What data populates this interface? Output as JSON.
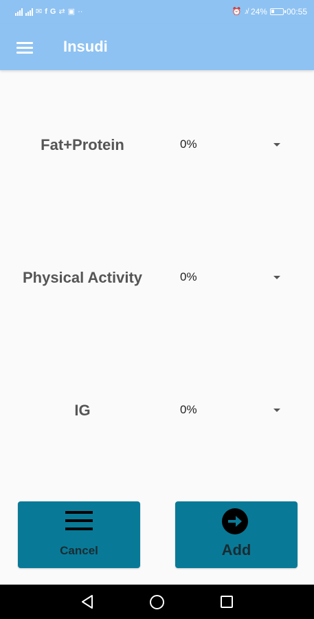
{
  "status_bar": {
    "left_icons": [
      "signal-icon",
      "signal-icon",
      "mail-icon",
      "facebook-icon",
      "google-icon",
      "transfer-icon",
      "image-icon",
      "more-icon"
    ],
    "more": "··",
    "battery_percent": "24%",
    "battery_level": 24,
    "time": "00:55"
  },
  "app_bar": {
    "title": "Insudi",
    "menu_icon": "menu-icon"
  },
  "rows": [
    {
      "label": "Fat+Protein",
      "value": "0%"
    },
    {
      "label": "Physical Activity",
      "value": "0%"
    },
    {
      "label": "IG",
      "value": "0%"
    }
  ],
  "buttons": {
    "cancel": {
      "label": "Cancel",
      "icon": "hamburger-icon"
    },
    "add": {
      "label": "Add",
      "icon": "arrow-right-circle-icon"
    }
  },
  "colors": {
    "app_bar": "#8ec2f2",
    "button": "#087a97",
    "background": "#fafafa"
  },
  "nav_bar": {
    "icons": [
      "back-icon",
      "home-icon",
      "recents-icon"
    ]
  }
}
